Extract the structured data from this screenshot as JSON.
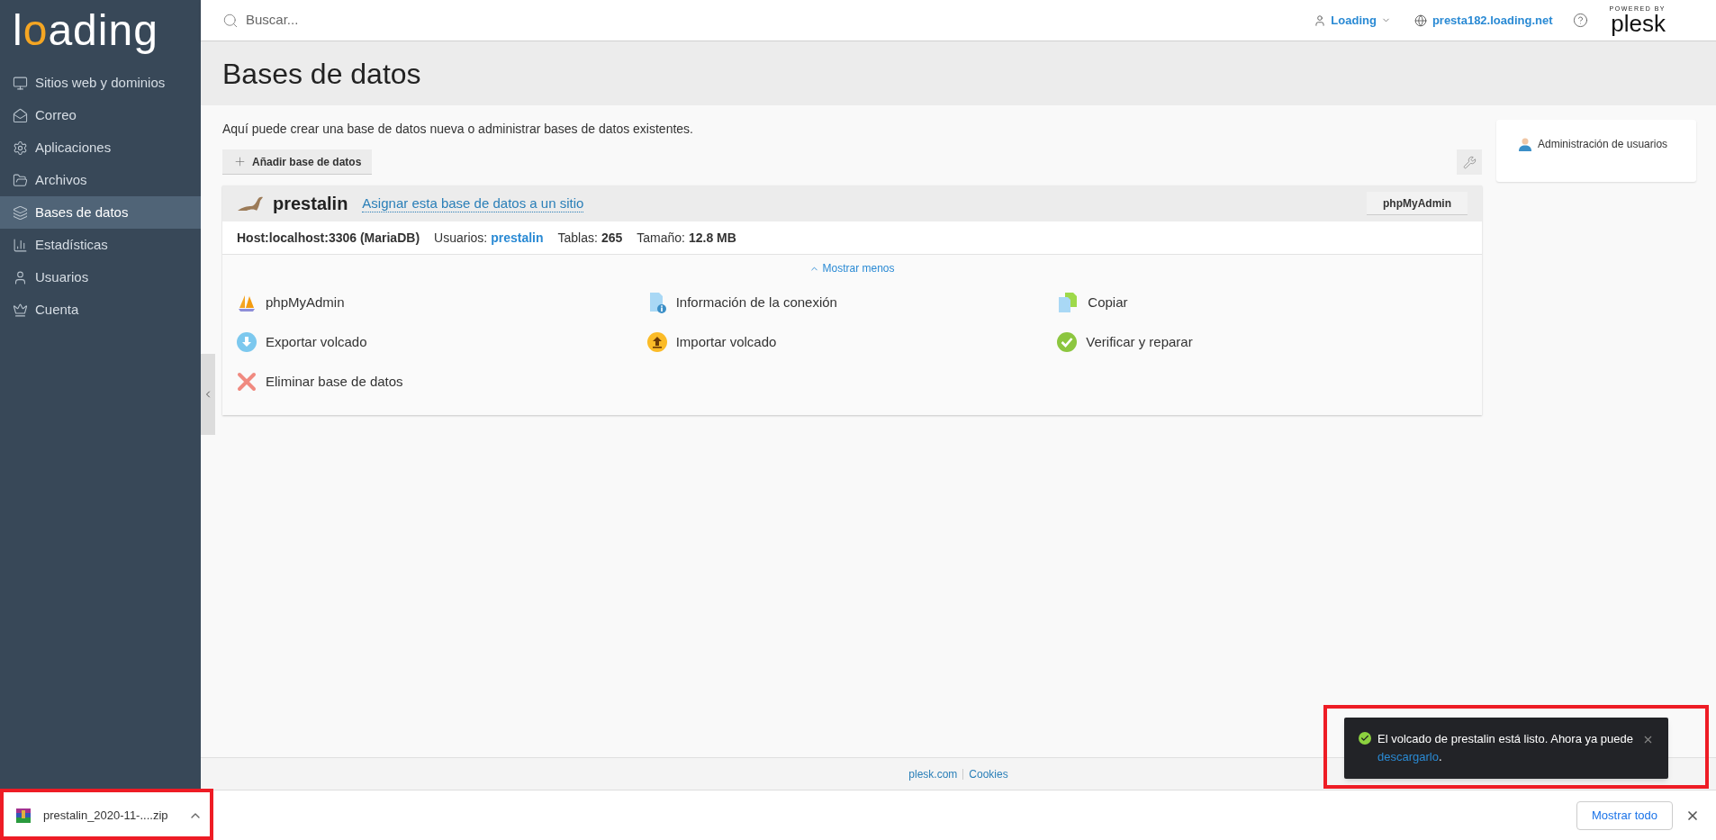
{
  "logo": {
    "lead": "l",
    "accent": "o",
    "rest": "ading"
  },
  "sidebar": {
    "items": [
      {
        "label": "Sitios web y dominios",
        "kind": "websites",
        "selected": false
      },
      {
        "label": "Correo",
        "kind": "mail",
        "selected": false
      },
      {
        "label": "Aplicaciones",
        "kind": "apps",
        "selected": false
      },
      {
        "label": "Archivos",
        "kind": "files",
        "selected": false
      },
      {
        "label": "Bases de datos",
        "kind": "databases",
        "selected": true
      },
      {
        "label": "Estadísticas",
        "kind": "stats",
        "selected": false
      },
      {
        "label": "Usuarios",
        "kind": "users",
        "selected": false
      },
      {
        "label": "Cuenta",
        "kind": "account",
        "selected": false
      }
    ]
  },
  "header": {
    "search": {
      "placeholder": "Buscar..."
    },
    "user": "Loading",
    "domain": "presta182.loading.net",
    "powered_by": "POWERED BY",
    "brand": "plesk"
  },
  "page": {
    "title": "Bases de datos",
    "description": "Aquí puede crear una base de datos nueva o administrar bases de datos existentes.",
    "add_button": "Añadir base de datos"
  },
  "database": {
    "name": "prestalin",
    "assign_link": "Asignar esta base de datos a un sitio",
    "phpmyadmin_button": "phpMyAdmin",
    "host": "Host:localhost:3306 (MariaDB)",
    "stats": [
      {
        "label": "Usuarios:",
        "value": "prestalin",
        "kind": "link"
      },
      {
        "label": "Tablas:",
        "value": "265",
        "kind": "plain"
      },
      {
        "label": "Tamaño:",
        "value": "12.8 MB",
        "kind": "plain"
      }
    ],
    "toggle": "Mostrar menos",
    "actions": [
      {
        "label": "phpMyAdmin",
        "kind": "phpmyadmin"
      },
      {
        "label": "Información de la conexión",
        "kind": "info"
      },
      {
        "label": "Copiar",
        "kind": "copy"
      },
      {
        "label": "Exportar volcado",
        "kind": "export"
      },
      {
        "label": "Importar volcado",
        "kind": "import"
      },
      {
        "label": "Verificar y reparar",
        "kind": "verify"
      },
      {
        "label": "Eliminar base de datos",
        "kind": "delete"
      }
    ]
  },
  "side_panel": {
    "link": "Administración de usuarios"
  },
  "footer": {
    "links": [
      "plesk.com",
      "Cookies"
    ]
  },
  "toast": {
    "text": "El volcado de prestalin está listo. Ahora ya puede",
    "link": "descargarlo",
    "tail": "."
  },
  "download_bar": {
    "file": "prestalin_2020-11-....zip",
    "show_all": "Mostrar todo"
  }
}
